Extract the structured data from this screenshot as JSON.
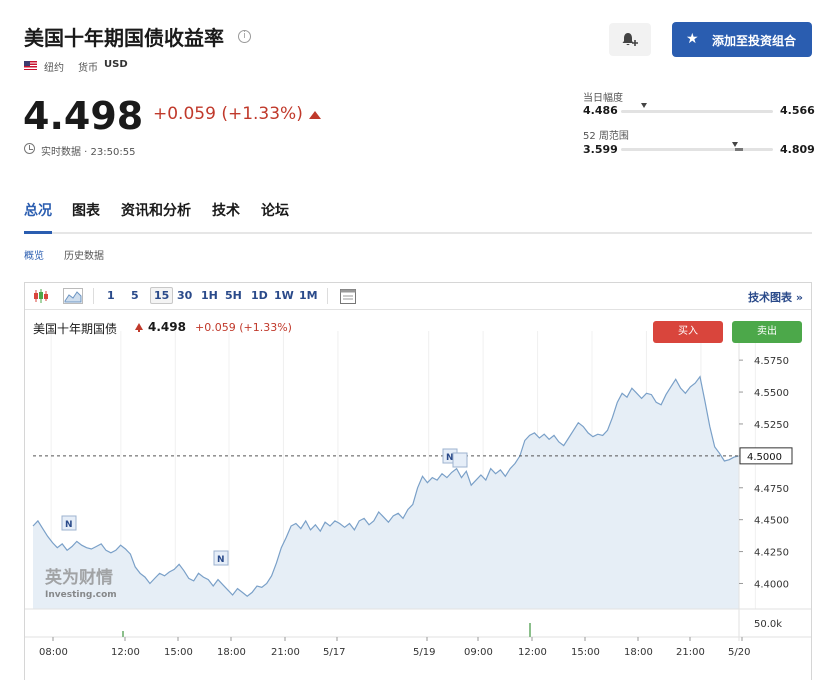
{
  "header": {
    "title": "美国十年期国债收益率",
    "exchange": "纽约",
    "currency_label": "货币",
    "currency": "USD",
    "add_watchlist": "添加至投资组合"
  },
  "quote": {
    "price": "4.498",
    "change": "+0.059 (+1.33%)",
    "realtime": "实时数据 · 23:50:55",
    "up_color": "#c0392b"
  },
  "ranges": {
    "day_label": "当日幅度",
    "day_low": "4.486",
    "day_high": "4.566",
    "day_current": 0.15,
    "week52_label": "52 周范围",
    "week52_low": "3.599",
    "week52_high": "4.809",
    "week52_current": 0.747
  },
  "nav": {
    "tabs": [
      "总况",
      "图表",
      "资讯和分析",
      "技术",
      "论坛"
    ],
    "active": "总况"
  },
  "subtabs": [
    "概览",
    "历史数据"
  ],
  "toolbar": {
    "intervals": [
      "1",
      "5",
      "15",
      "30",
      "1H",
      "5H",
      "1D",
      "1W",
      "1M"
    ],
    "active_interval": "15",
    "tech_chart": "技术图表 »"
  },
  "legend": {
    "name": "美国十年期国债",
    "price": "4.498",
    "change": "+0.059 (+1.33%)"
  },
  "trade": {
    "buy": "买入",
    "sell": "卖出"
  },
  "watermark": {
    "cn": "英为财情",
    "en": "Investing.com"
  },
  "chart_data": {
    "type": "area",
    "y_ticks": [
      "4.5750",
      "4.5500",
      "4.5250",
      "4.5000",
      "4.4750",
      "4.4500",
      "4.4250",
      "4.4000"
    ],
    "ylim": [
      4.38,
      4.59
    ],
    "current_price_label": "4.5000",
    "volume_label": "50.0k",
    "x_ticks": [
      "08:00",
      "12:00",
      "15:00",
      "18:00",
      "21:00",
      "5/17",
      "5/19",
      "09:00",
      "12:00",
      "15:00",
      "18:00",
      "21:00",
      "5/20"
    ],
    "news_markers": [
      "N",
      "N",
      "N"
    ],
    "line_color": "#7aa0c8",
    "fill_color": "#e6eef6",
    "values": [
      4.445,
      4.449,
      4.443,
      4.437,
      4.432,
      4.428,
      4.431,
      4.426,
      4.429,
      4.433,
      4.43,
      4.428,
      4.427,
      4.429,
      4.431,
      4.426,
      4.424,
      4.426,
      4.43,
      4.427,
      4.423,
      4.413,
      4.408,
      4.405,
      4.4,
      4.404,
      4.408,
      4.406,
      4.409,
      4.411,
      4.415,
      4.41,
      4.404,
      4.402,
      4.408,
      4.405,
      4.403,
      4.398,
      4.403,
      4.399,
      4.395,
      4.391,
      4.396,
      4.393,
      4.39,
      4.393,
      4.398,
      4.397,
      4.4,
      4.406,
      4.416,
      4.428,
      4.436,
      4.445,
      4.447,
      4.443,
      4.449,
      4.442,
      4.446,
      4.441,
      4.448,
      4.445,
      4.449,
      4.447,
      4.444,
      4.447,
      4.442,
      4.449,
      4.451,
      4.446,
      4.449,
      4.456,
      4.452,
      4.448,
      4.453,
      4.455,
      4.451,
      4.458,
      4.462,
      4.475,
      4.484,
      4.479,
      4.483,
      4.481,
      4.486,
      4.483,
      4.487,
      4.49,
      4.483,
      4.488,
      4.477,
      4.481,
      4.485,
      4.481,
      4.49,
      4.486,
      4.489,
      4.484,
      4.49,
      4.494,
      4.5,
      4.512,
      4.516,
      4.518,
      4.514,
      4.517,
      4.513,
      4.516,
      4.511,
      4.508,
      4.514,
      4.52,
      4.526,
      4.523,
      4.518,
      4.515,
      4.517,
      4.516,
      4.52,
      4.53,
      4.542,
      4.549,
      4.546,
      4.553,
      4.549,
      4.545,
      4.549,
      4.548,
      4.542,
      4.54,
      4.548,
      4.554,
      4.56,
      4.553,
      4.549,
      4.554,
      4.557,
      4.562,
      4.543,
      4.523,
      4.507,
      4.502,
      4.496,
      4.497,
      4.499,
      4.5
    ]
  }
}
